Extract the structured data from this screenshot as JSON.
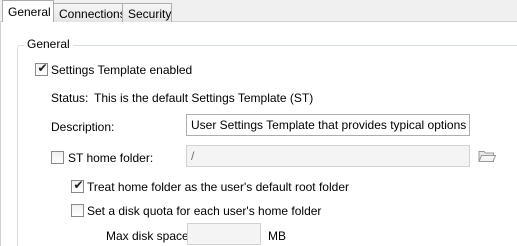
{
  "tabs": [
    {
      "label": "General",
      "active": true
    },
    {
      "label": "Connections",
      "active": false
    },
    {
      "label": "Security",
      "active": false
    }
  ],
  "group": {
    "legend": "General"
  },
  "settings_template": {
    "label": "Settings Template enabled",
    "checked": true
  },
  "status": {
    "label": "Status:",
    "value": "This is the default Settings Template (ST)"
  },
  "description": {
    "label": "Description:",
    "value": "User Settings Template that provides typical options to m"
  },
  "st_home_folder": {
    "label": "ST home folder:",
    "checked": false,
    "value": "/",
    "icon": "folder-icon"
  },
  "treat_home_root": {
    "label": "Treat home folder as the user's default root folder",
    "checked": true
  },
  "disk_quota": {
    "label": "Set a disk quota for each user's home folder",
    "checked": false
  },
  "max_disk_space": {
    "label": "Max disk space:",
    "value": "",
    "unit": "MB"
  },
  "colors": {
    "panel": "#ffffff",
    "background": "#f0f0f0",
    "border": "#abadb3"
  }
}
